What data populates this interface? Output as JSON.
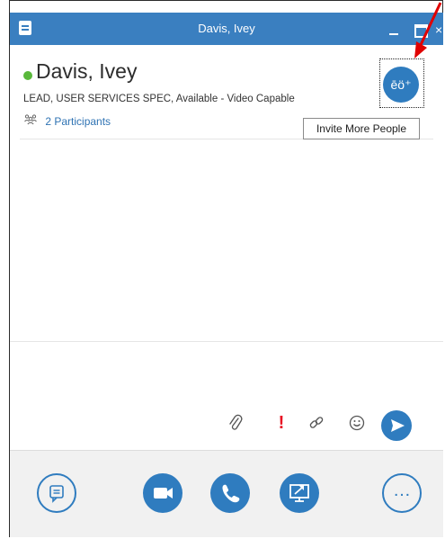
{
  "window": {
    "title": "Davis, Ivey",
    "close_glyph": "×"
  },
  "contact": {
    "name": "Davis, Ivey",
    "subtitle": "LEAD, USER SERVICES SPEC,  Available - Video Capable",
    "presence_color": "#59b83b"
  },
  "participants": {
    "icon": "participants-icon",
    "label": "2 Participants"
  },
  "invite": {
    "icon": "add-people-icon",
    "glyph": "ēö⁺",
    "tooltip": "Invite More People"
  },
  "compose": {
    "tools": [
      {
        "name": "attach-file-icon"
      },
      {
        "name": "importance-icon",
        "glyph": "!"
      },
      {
        "name": "link-icon"
      },
      {
        "name": "emoticon-icon"
      }
    ],
    "send_icon": "send-icon"
  },
  "bottom_toolbar": {
    "buttons": [
      "im-button",
      "video-button",
      "call-button",
      "present-screen-button",
      "more-options-button"
    ],
    "more_glyph": "…"
  },
  "colors": {
    "accent": "#2f7cbf",
    "title_bar": "#3a7fc0",
    "importance": "#e81123"
  }
}
